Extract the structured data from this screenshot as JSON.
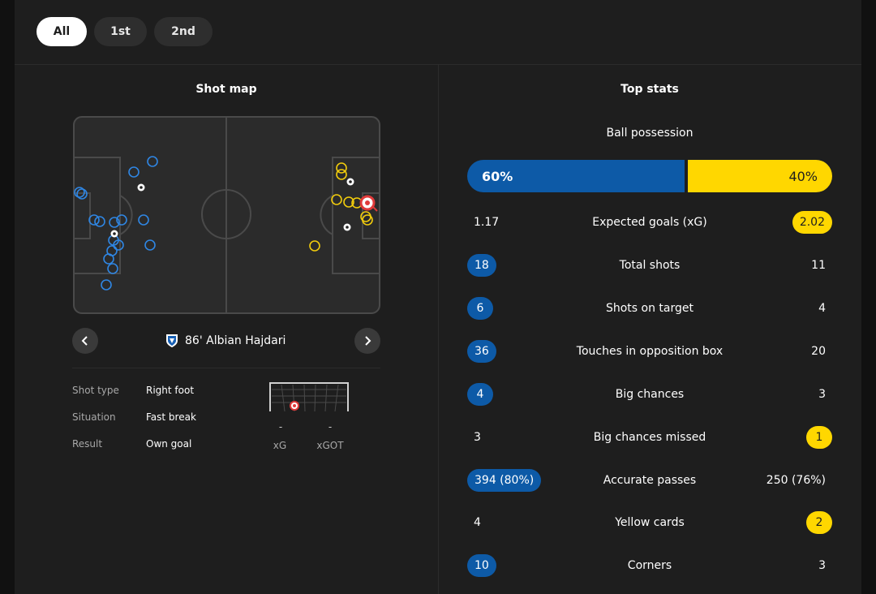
{
  "period_tabs": [
    {
      "label": "All",
      "active": true
    },
    {
      "label": "1st",
      "active": false
    },
    {
      "label": "2nd",
      "active": false
    }
  ],
  "shot_map": {
    "title": "Shot map",
    "selected_shot": {
      "minute_player": "86' Albian Hajdari",
      "details": [
        {
          "label": "Shot type",
          "value": "Right foot"
        },
        {
          "label": "Situation",
          "value": "Fast break"
        },
        {
          "label": "Result",
          "value": "Own goal"
        }
      ],
      "xg": "-",
      "xg_label": "xG",
      "xgot": "-",
      "xgot_label": "xGOT"
    },
    "prev_icon": "chevron-left-icon",
    "next_icon": "chevron-right-icon",
    "home_color": "#2f86e3",
    "away_color": "#f2cc0c",
    "own_goal_color": "#e03a3a"
  },
  "top_stats": {
    "title": "Top stats",
    "possession": {
      "label": "Ball possession",
      "home": "60%",
      "away": "40%",
      "home_value": 60,
      "away_value": 40
    },
    "rows": [
      {
        "label": "Expected goals (xG)",
        "home": "1.17",
        "away": "2.02",
        "highlight": "away"
      },
      {
        "label": "Total shots",
        "home": "18",
        "away": "11",
        "highlight": "home"
      },
      {
        "label": "Shots on target",
        "home": "6",
        "away": "4",
        "highlight": "home"
      },
      {
        "label": "Touches in opposition box",
        "home": "36",
        "away": "20",
        "highlight": "home"
      },
      {
        "label": "Big chances",
        "home": "4",
        "away": "3",
        "highlight": "home"
      },
      {
        "label": "Big chances missed",
        "home": "3",
        "away": "1",
        "highlight": "away"
      },
      {
        "label": "Accurate passes",
        "home": "394 (80%)",
        "away": "250 (76%)",
        "highlight": "home"
      },
      {
        "label": "Yellow cards",
        "home": "4",
        "away": "2",
        "highlight": "away"
      },
      {
        "label": "Corners",
        "home": "10",
        "away": "3",
        "highlight": "home"
      }
    ],
    "home_color": "#0d5aa7",
    "away_color": "#ffd700"
  }
}
